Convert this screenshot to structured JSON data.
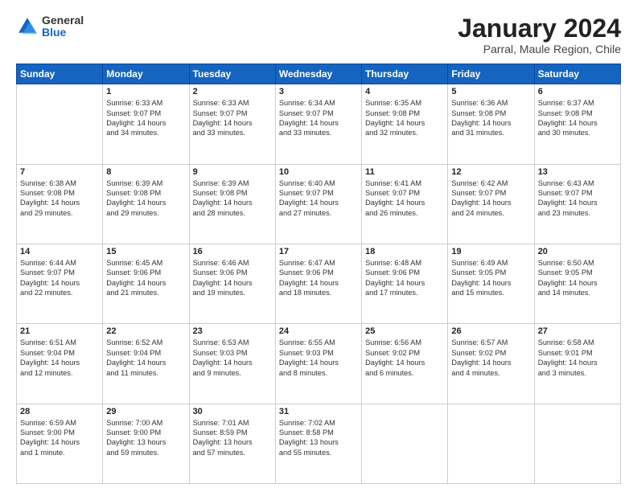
{
  "header": {
    "logo_general": "General",
    "logo_blue": "Blue",
    "month_title": "January 2024",
    "subtitle": "Parral, Maule Region, Chile"
  },
  "days_of_week": [
    "Sunday",
    "Monday",
    "Tuesday",
    "Wednesday",
    "Thursday",
    "Friday",
    "Saturday"
  ],
  "weeks": [
    [
      {
        "day": "",
        "content": ""
      },
      {
        "day": "1",
        "content": "Sunrise: 6:33 AM\nSunset: 9:07 PM\nDaylight: 14 hours\nand 34 minutes."
      },
      {
        "day": "2",
        "content": "Sunrise: 6:33 AM\nSunset: 9:07 PM\nDaylight: 14 hours\nand 33 minutes."
      },
      {
        "day": "3",
        "content": "Sunrise: 6:34 AM\nSunset: 9:07 PM\nDaylight: 14 hours\nand 33 minutes."
      },
      {
        "day": "4",
        "content": "Sunrise: 6:35 AM\nSunset: 9:08 PM\nDaylight: 14 hours\nand 32 minutes."
      },
      {
        "day": "5",
        "content": "Sunrise: 6:36 AM\nSunset: 9:08 PM\nDaylight: 14 hours\nand 31 minutes."
      },
      {
        "day": "6",
        "content": "Sunrise: 6:37 AM\nSunset: 9:08 PM\nDaylight: 14 hours\nand 30 minutes."
      }
    ],
    [
      {
        "day": "7",
        "content": "Sunrise: 6:38 AM\nSunset: 9:08 PM\nDaylight: 14 hours\nand 29 minutes."
      },
      {
        "day": "8",
        "content": "Sunrise: 6:39 AM\nSunset: 9:08 PM\nDaylight: 14 hours\nand 29 minutes."
      },
      {
        "day": "9",
        "content": "Sunrise: 6:39 AM\nSunset: 9:08 PM\nDaylight: 14 hours\nand 28 minutes."
      },
      {
        "day": "10",
        "content": "Sunrise: 6:40 AM\nSunset: 9:07 PM\nDaylight: 14 hours\nand 27 minutes."
      },
      {
        "day": "11",
        "content": "Sunrise: 6:41 AM\nSunset: 9:07 PM\nDaylight: 14 hours\nand 26 minutes."
      },
      {
        "day": "12",
        "content": "Sunrise: 6:42 AM\nSunset: 9:07 PM\nDaylight: 14 hours\nand 24 minutes."
      },
      {
        "day": "13",
        "content": "Sunrise: 6:43 AM\nSunset: 9:07 PM\nDaylight: 14 hours\nand 23 minutes."
      }
    ],
    [
      {
        "day": "14",
        "content": "Sunrise: 6:44 AM\nSunset: 9:07 PM\nDaylight: 14 hours\nand 22 minutes."
      },
      {
        "day": "15",
        "content": "Sunrise: 6:45 AM\nSunset: 9:06 PM\nDaylight: 14 hours\nand 21 minutes."
      },
      {
        "day": "16",
        "content": "Sunrise: 6:46 AM\nSunset: 9:06 PM\nDaylight: 14 hours\nand 19 minutes."
      },
      {
        "day": "17",
        "content": "Sunrise: 6:47 AM\nSunset: 9:06 PM\nDaylight: 14 hours\nand 18 minutes."
      },
      {
        "day": "18",
        "content": "Sunrise: 6:48 AM\nSunset: 9:06 PM\nDaylight: 14 hours\nand 17 minutes."
      },
      {
        "day": "19",
        "content": "Sunrise: 6:49 AM\nSunset: 9:05 PM\nDaylight: 14 hours\nand 15 minutes."
      },
      {
        "day": "20",
        "content": "Sunrise: 6:50 AM\nSunset: 9:05 PM\nDaylight: 14 hours\nand 14 minutes."
      }
    ],
    [
      {
        "day": "21",
        "content": "Sunrise: 6:51 AM\nSunset: 9:04 PM\nDaylight: 14 hours\nand 12 minutes."
      },
      {
        "day": "22",
        "content": "Sunrise: 6:52 AM\nSunset: 9:04 PM\nDaylight: 14 hours\nand 11 minutes."
      },
      {
        "day": "23",
        "content": "Sunrise: 6:53 AM\nSunset: 9:03 PM\nDaylight: 14 hours\nand 9 minutes."
      },
      {
        "day": "24",
        "content": "Sunrise: 6:55 AM\nSunset: 9:03 PM\nDaylight: 14 hours\nand 8 minutes."
      },
      {
        "day": "25",
        "content": "Sunrise: 6:56 AM\nSunset: 9:02 PM\nDaylight: 14 hours\nand 6 minutes."
      },
      {
        "day": "26",
        "content": "Sunrise: 6:57 AM\nSunset: 9:02 PM\nDaylight: 14 hours\nand 4 minutes."
      },
      {
        "day": "27",
        "content": "Sunrise: 6:58 AM\nSunset: 9:01 PM\nDaylight: 14 hours\nand 3 minutes."
      }
    ],
    [
      {
        "day": "28",
        "content": "Sunrise: 6:59 AM\nSunset: 9:00 PM\nDaylight: 14 hours\nand 1 minute."
      },
      {
        "day": "29",
        "content": "Sunrise: 7:00 AM\nSunset: 9:00 PM\nDaylight: 13 hours\nand 59 minutes."
      },
      {
        "day": "30",
        "content": "Sunrise: 7:01 AM\nSunset: 8:59 PM\nDaylight: 13 hours\nand 57 minutes."
      },
      {
        "day": "31",
        "content": "Sunrise: 7:02 AM\nSunset: 8:58 PM\nDaylight: 13 hours\nand 55 minutes."
      },
      {
        "day": "",
        "content": ""
      },
      {
        "day": "",
        "content": ""
      },
      {
        "day": "",
        "content": ""
      }
    ]
  ]
}
